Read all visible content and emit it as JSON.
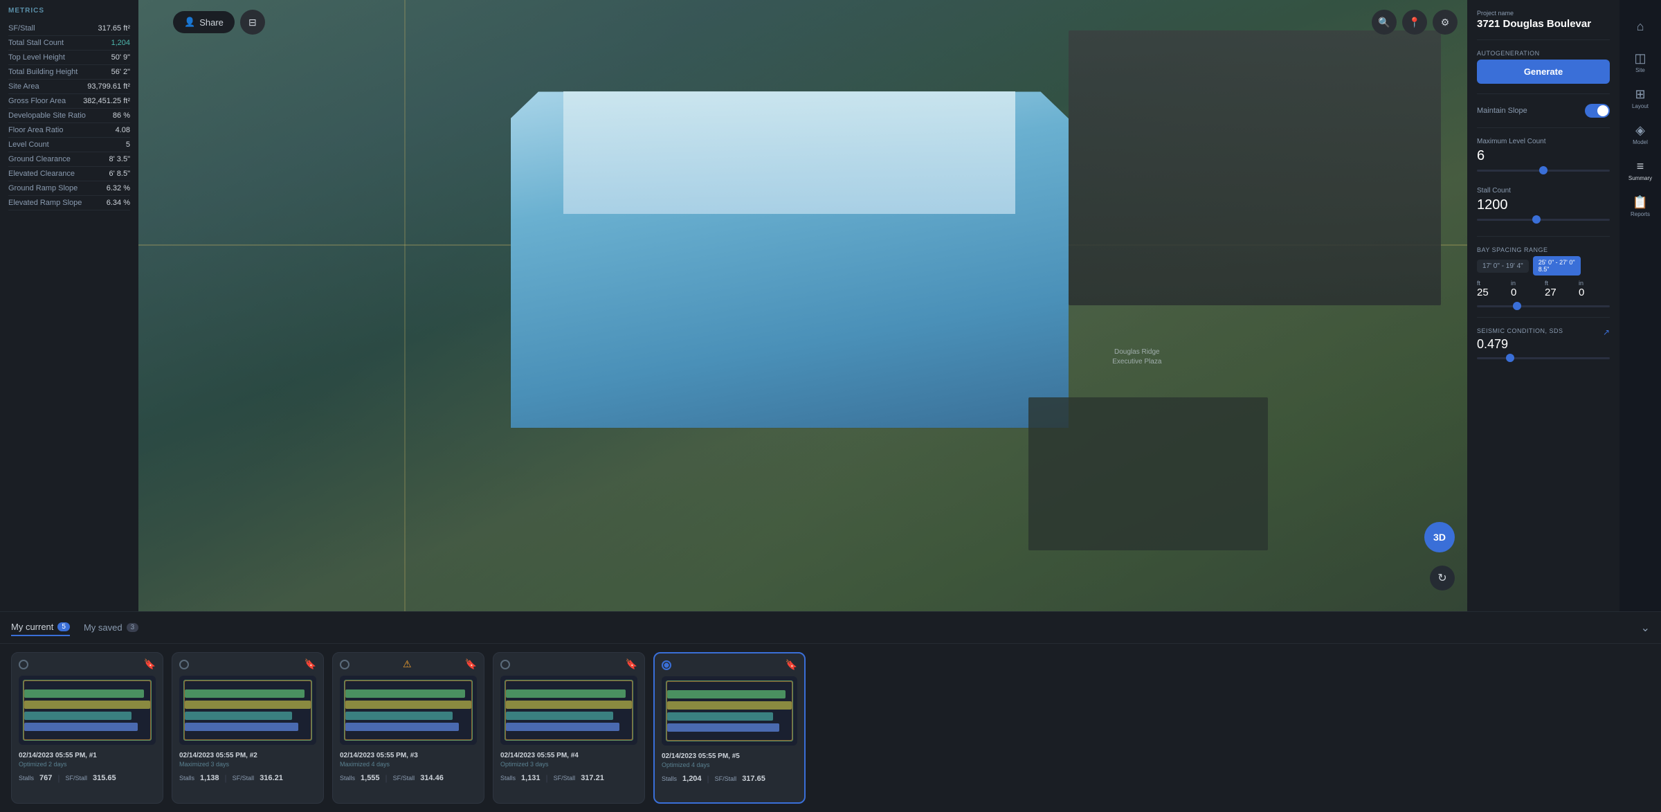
{
  "leftPanel": {
    "title": "METRICS",
    "metrics": [
      {
        "label": "SF/Stall",
        "value": "317.65 ft²",
        "highlight": false
      },
      {
        "label": "Total Stall Count",
        "value": "1,204",
        "highlight": true
      },
      {
        "label": "Top Level Height",
        "value": "50' 9\"",
        "highlight": false
      },
      {
        "label": "Total Building Height",
        "value": "56' 2\"",
        "highlight": false
      },
      {
        "label": "Site Area",
        "value": "93,799.61 ft²",
        "highlight": false
      },
      {
        "label": "Gross Floor Area",
        "value": "382,451.25 ft²",
        "highlight": false
      },
      {
        "label": "Developable Site Ratio",
        "value": "86 %",
        "highlight": false
      },
      {
        "label": "Floor Area Ratio",
        "value": "4.08",
        "highlight": false
      },
      {
        "label": "Level Count",
        "value": "5",
        "highlight": false
      },
      {
        "label": "Ground Clearance",
        "value": "8' 3.5\"",
        "highlight": false
      },
      {
        "label": "Elevated Clearance",
        "value": "6' 8.5\"",
        "highlight": false
      },
      {
        "label": "Ground Ramp Slope",
        "value": "6.32 %",
        "highlight": false
      },
      {
        "label": "Elevated Ramp Slope",
        "value": "6.34 %",
        "highlight": false
      }
    ]
  },
  "mapToolbar": {
    "shareLabel": "Share",
    "badge3D": "3D"
  },
  "rightPanel": {
    "projectNameLabel": "Project name",
    "projectName": "3721 Douglas Boulevar",
    "autogenLabel": "AUTOGENERATION",
    "generateLabel": "Generate",
    "maintainSlopeLabel": "Maintain Slope",
    "maxLevelCountLabel": "Maximum Level Count",
    "maxLevelCountValue": "6",
    "stallCountLabel": "Stall Count",
    "stallCountValue": "1200",
    "baySpacingLabel": "Bay Spacing Range",
    "bayRangeLeft": "17' 0\" - 19' 4\"",
    "bayRangeRight": "25' 0\" - 27' 0\" 8.5\"",
    "bayDims": {
      "ft1Label": "ft",
      "ft1Value": "25",
      "in1Label": "in",
      "in1Value": "0",
      "ft2Label": "ft",
      "ft2Value": "27",
      "in2Label": "in",
      "in2Value": "0"
    },
    "seismicLabel": "Seismic Condition, Sds",
    "seismicValue": "0.479"
  },
  "farRightNav": {
    "items": [
      {
        "icon": "⌂",
        "label": "Home"
      },
      {
        "icon": "◫",
        "label": "Site"
      },
      {
        "icon": "⊞",
        "label": "Layout"
      },
      {
        "icon": "◈",
        "label": "Model"
      },
      {
        "icon": "≡",
        "label": "Summary"
      },
      {
        "icon": "📋",
        "label": "Reports"
      }
    ]
  },
  "bottomPanel": {
    "currentTabLabel": "My current",
    "currentTabCount": "5",
    "savedTabLabel": "My saved",
    "savedTabCount": "3",
    "cards": [
      {
        "id": 1,
        "date": "02/14/2023 05:55 PM, #1",
        "desc": "Optimized 2 days",
        "stalls": "767",
        "sfPerStall": "315.65",
        "selected": false,
        "hasWarning": false
      },
      {
        "id": 2,
        "date": "02/14/2023 05:55 PM, #2",
        "desc": "Maximized 3 days",
        "stalls": "1,138",
        "sfPerStall": "316.21",
        "selected": false,
        "hasWarning": false
      },
      {
        "id": 3,
        "date": "02/14/2023 05:55 PM, #3",
        "desc": "Maximized 4 days",
        "stalls": "1,555",
        "sfPerStall": "314.46",
        "selected": false,
        "hasWarning": true
      },
      {
        "id": 4,
        "date": "02/14/2023 05:55 PM, #4",
        "desc": "Optimized 3 days",
        "stalls": "1,131",
        "sfPerStall": "317.21",
        "selected": false,
        "hasWarning": false
      },
      {
        "id": 5,
        "date": "02/14/2023 05:55 PM, #5",
        "desc": "Optimized 4 days",
        "stalls": "1,204",
        "sfPerStall": "317.65",
        "selected": true,
        "hasWarning": false
      }
    ],
    "stallsLabel": "Stalls",
    "sfStallLabel": "SF/Stall"
  }
}
